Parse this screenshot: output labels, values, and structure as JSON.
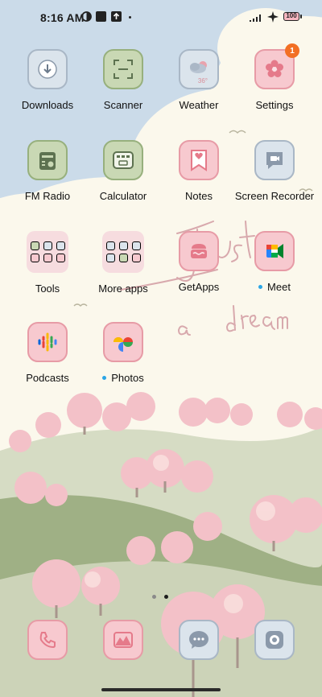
{
  "status_bar": {
    "time": "8:16 AM",
    "battery": "100"
  },
  "apps": [
    {
      "label": "Downloads",
      "icon": "download-icon"
    },
    {
      "label": "Scanner",
      "icon": "scanner-icon"
    },
    {
      "label": "Weather",
      "icon": "weather-icon",
      "temp": "36°"
    },
    {
      "label": "Settings",
      "icon": "settings-icon",
      "badge": "1"
    },
    {
      "label": "FM Radio",
      "icon": "radio-icon"
    },
    {
      "label": "Calculator",
      "icon": "calculator-icon"
    },
    {
      "label": "Notes",
      "icon": "notes-icon"
    },
    {
      "label": "Screen Recorder",
      "icon": "screen-recorder-icon"
    },
    {
      "label": "Tools",
      "icon": "folder-icon"
    },
    {
      "label": "More apps",
      "icon": "folder-icon"
    },
    {
      "label": "GetApps",
      "icon": "getapps-icon"
    },
    {
      "label": "Meet",
      "icon": "meet-icon"
    },
    {
      "label": "Podcasts",
      "icon": "podcasts-icon"
    },
    {
      "label": "Photos",
      "icon": "photos-icon"
    }
  ],
  "dock": [
    {
      "icon": "phone-icon"
    },
    {
      "icon": "gallery-icon"
    },
    {
      "icon": "messages-icon"
    },
    {
      "icon": "camera-icon"
    }
  ],
  "wallpaper_text": "Just a dream",
  "colors": {
    "sky": "#c9d9ea",
    "cloud": "#fbf7ea",
    "hills": "#a8b88e",
    "blossom": "#f0b9c2",
    "accent_blue": "#2aa5e6",
    "badge": "#f26f24"
  },
  "pages": {
    "count": 2,
    "current": 2
  }
}
